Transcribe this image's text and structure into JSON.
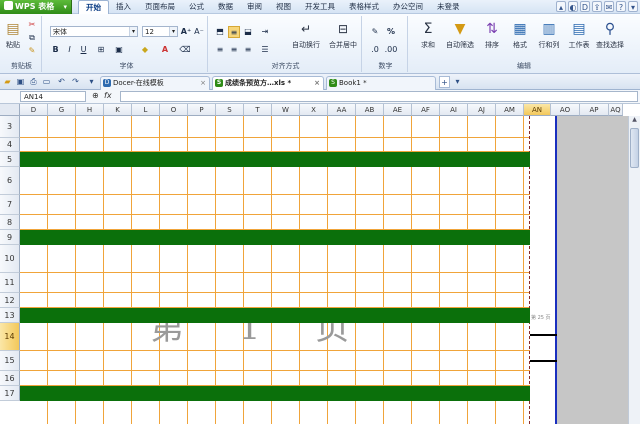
{
  "app": {
    "logo": "WPS 表格"
  },
  "menu": {
    "tabs": [
      "开始",
      "插入",
      "页面布局",
      "公式",
      "数据",
      "审阅",
      "视图",
      "开发工具",
      "表格样式",
      "办公空间",
      "未登录"
    ],
    "active_tab": "开始"
  },
  "ribbon": {
    "clipboard": {
      "paste": "粘贴",
      "label": "剪贴板"
    },
    "font": {
      "name": "宋体",
      "size": "12",
      "label": "字体",
      "bold": "B",
      "italic": "I",
      "underline": "U"
    },
    "align": {
      "wrap": "自动换行",
      "merge": "合并居中",
      "label": "对齐方式"
    },
    "number": {
      "label": "数字",
      "percent": "%"
    },
    "edit": {
      "sum": "求和",
      "filter": "自动筛选",
      "sort": "排序",
      "format": "格式",
      "rowcol": "行和列",
      "sheet": "工作表",
      "find": "查找选择",
      "label": "编辑"
    }
  },
  "doc_tabs": [
    {
      "name": "Docer-在线模板",
      "active": false
    },
    {
      "name": "成绩条预览方…xls *",
      "active": true
    },
    {
      "name": "Book1 *",
      "active": false
    }
  ],
  "formula_bar": {
    "cell_ref": "AN14",
    "fx": "fx",
    "value": ""
  },
  "grid": {
    "columns": [
      "D",
      "G",
      "H",
      "K",
      "L",
      "O",
      "P",
      "S",
      "T",
      "W",
      "X",
      "AA",
      "AB",
      "AE",
      "AF",
      "AI",
      "AJ",
      "AM",
      "AN",
      "AO",
      "AP",
      "AQ"
    ],
    "selected_column": "AN",
    "rows": [
      "3",
      "4",
      "5",
      "6",
      "7",
      "8",
      "9",
      "10",
      "11",
      "12",
      "13",
      "14",
      "15",
      "16",
      "17"
    ],
    "selected_row": "14",
    "green_rows": [
      "5",
      "9",
      "13",
      "17"
    ],
    "watermark": "第 1 页",
    "page_indicator": "第 25 页"
  },
  "colors": {
    "grid_line": "#f0a43a",
    "green_band": "#0b700b",
    "selection": "#f3c85a",
    "brand": "#2f8c17"
  }
}
